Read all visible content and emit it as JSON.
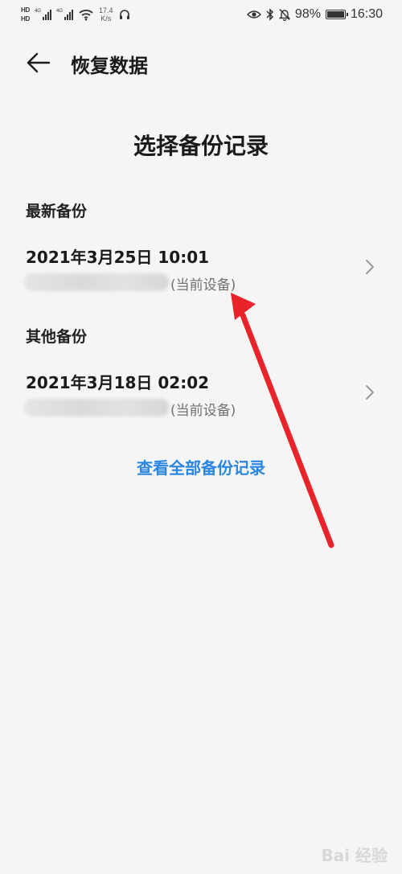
{
  "status_bar": {
    "hd_badges": [
      "HD",
      "HD"
    ],
    "signal_tags": [
      "4G",
      "4G"
    ],
    "net_speed_value": "17.4",
    "net_speed_unit": "K/s",
    "battery_percent": "98%",
    "battery_level": 0.98,
    "time": "16:30",
    "icons": [
      "eye-icon",
      "bluetooth-icon",
      "mute-bell-icon",
      "battery-icon",
      "wifi-icon",
      "headset-icon"
    ]
  },
  "header": {
    "title": "恢复数据"
  },
  "section_heading": "选择备份记录",
  "latest_group": {
    "label": "最新备份",
    "item": {
      "date": "2021年3月25日 10:01",
      "device_tag": "(当前设备)"
    }
  },
  "other_group": {
    "label": "其他备份",
    "item": {
      "date": "2021年3月18日 02:02",
      "device_tag": "(当前设备)"
    }
  },
  "view_all_label": "查看全部备份记录",
  "colors": {
    "accent": "#2a86e0",
    "annotation_arrow": "#e8232a",
    "background": "#f5f5f5"
  },
  "watermark": "Bai 经验"
}
